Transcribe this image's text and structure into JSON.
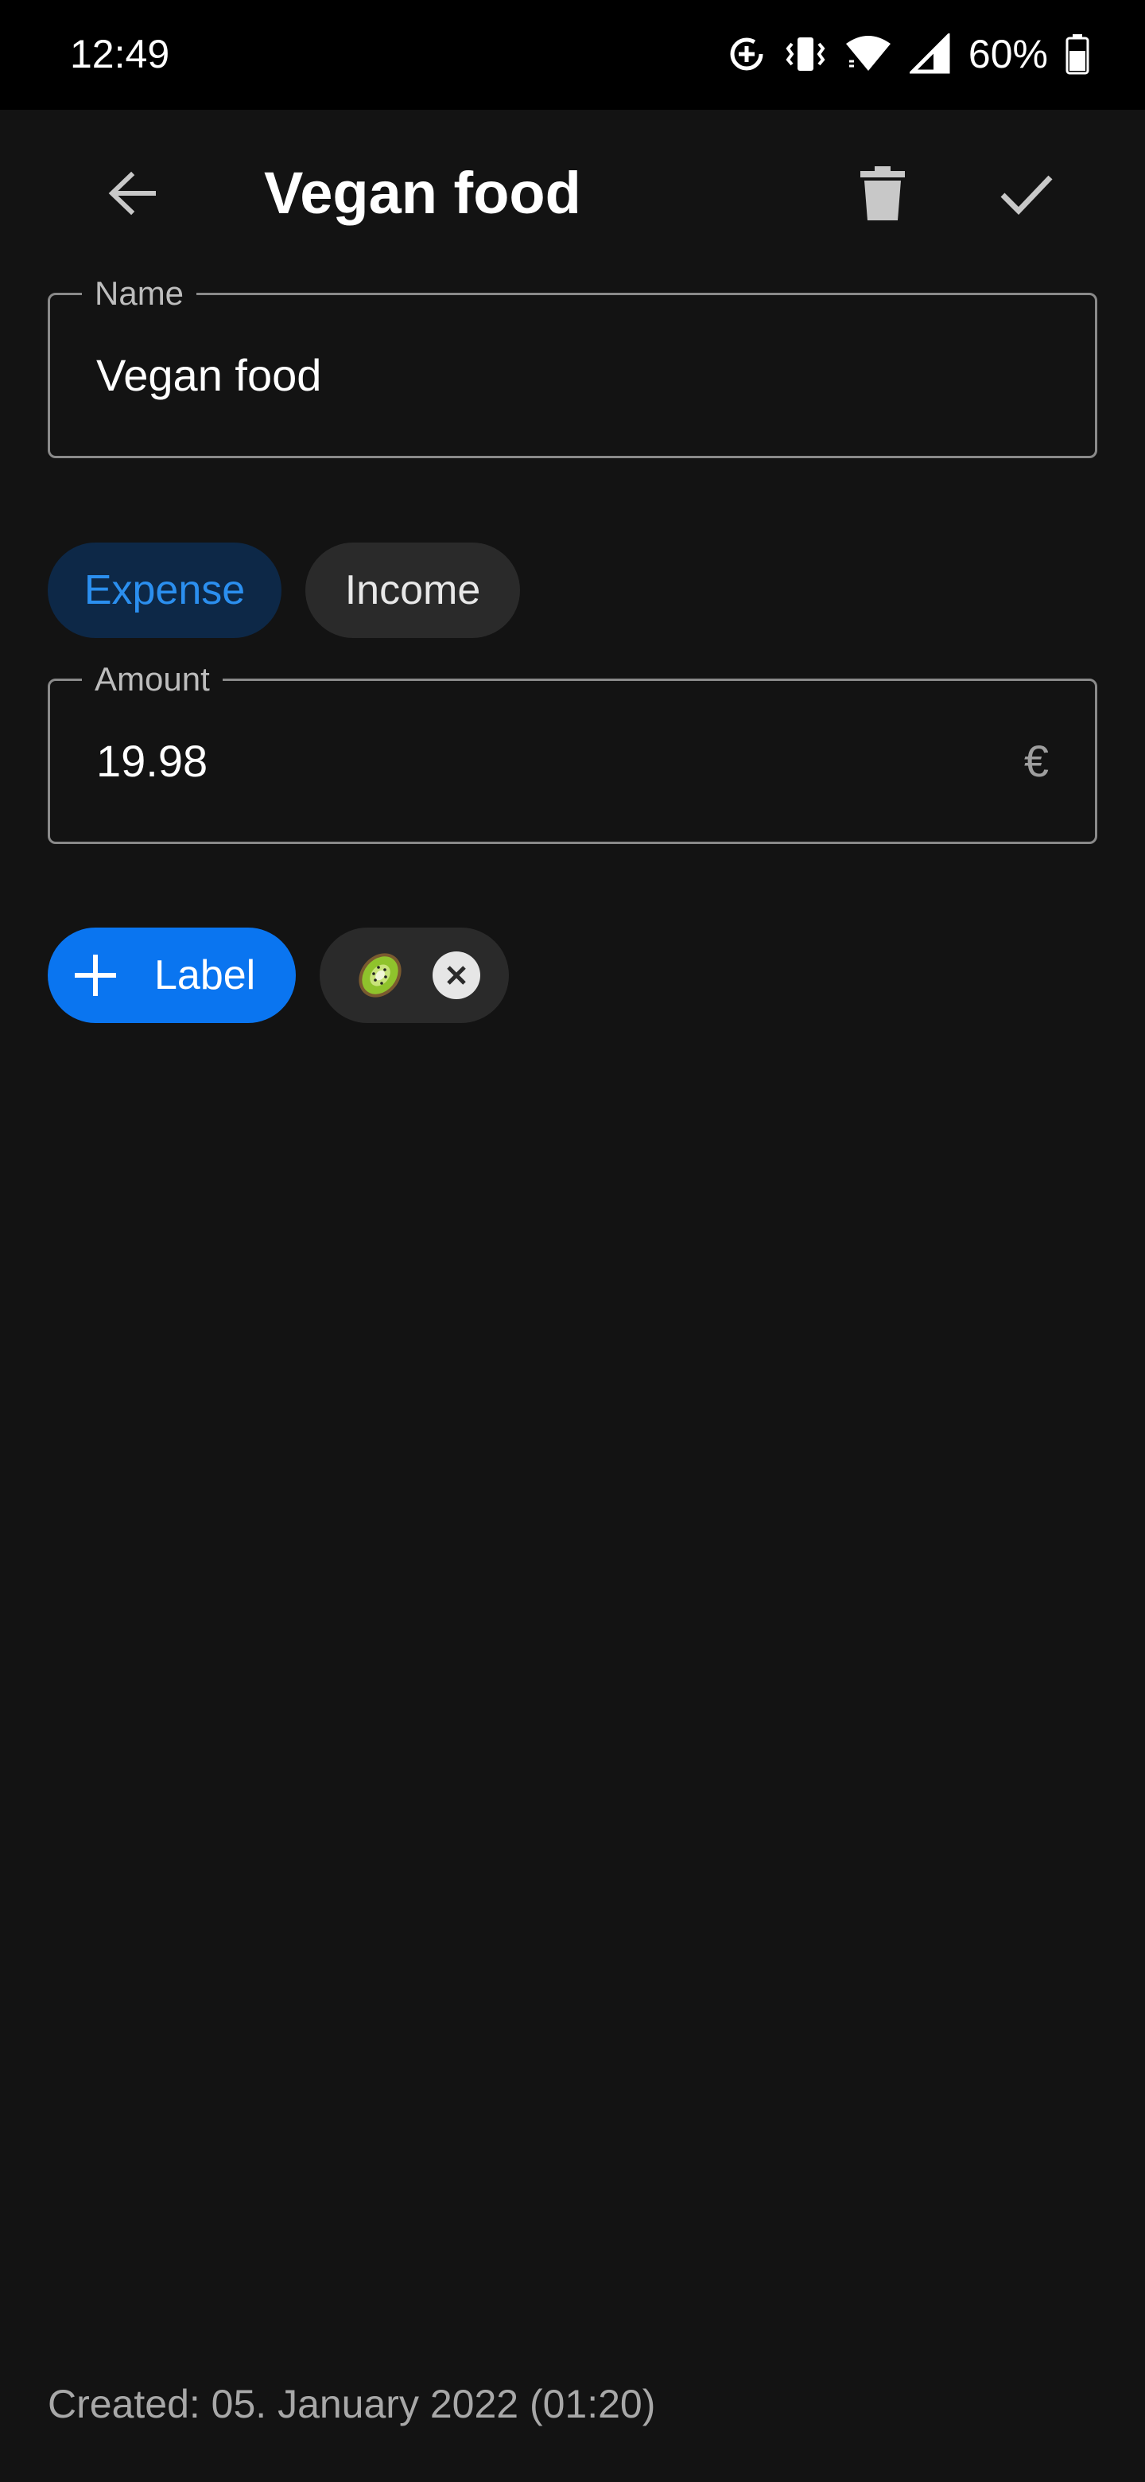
{
  "status_bar": {
    "time": "12:49",
    "battery_percent": "60%",
    "icons": [
      "data-saver-icon",
      "vibrate-icon",
      "wifi-icon",
      "signal-icon",
      "battery-icon"
    ]
  },
  "app_bar": {
    "title": "Vegan food",
    "icons": [
      "back-arrow-icon",
      "trash-icon",
      "check-icon"
    ]
  },
  "form": {
    "name_label": "Name",
    "name_value": "Vegan food",
    "type_options": [
      {
        "label": "Expense",
        "selected": true
      },
      {
        "label": "Income",
        "selected": false
      }
    ],
    "amount_label": "Amount",
    "amount_value": "19.98",
    "currency_symbol": "€",
    "add_label_button": "Label",
    "labels": [
      {
        "emoji": "🥝",
        "icon": "kiwi-icon"
      }
    ]
  },
  "footer": {
    "created": "Created: 05. January 2022 (01:20)"
  },
  "colors": {
    "background": "#131313",
    "accent": "#0a75f0",
    "selected_chip_bg": "#0d2847",
    "selected_chip_text": "#2b8fef",
    "chip_bg": "#2a2a2a"
  }
}
